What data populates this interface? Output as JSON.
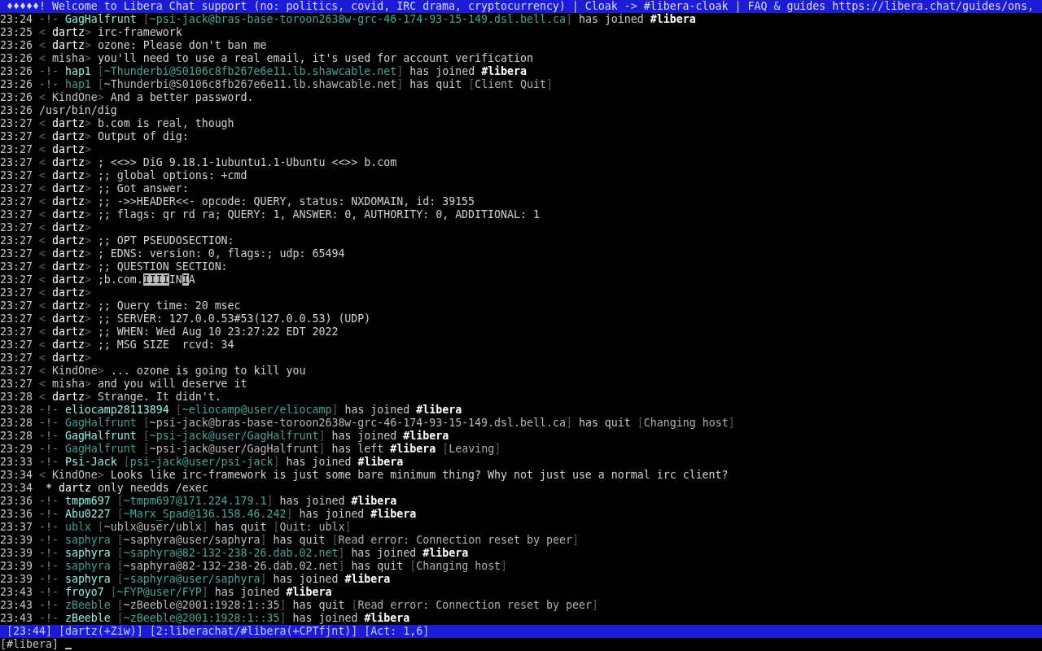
{
  "topic": "♦♦♦♦♦! Welcome to Libera Chat support (no: politics, covid, IRC drama, cryptocurrency) | Cloak -> #libera-cloak | FAQ & guides https://libera.chat/guides/ons,",
  "lines": [
    {
      "time": "23:24",
      "parts": [
        {
          "kind": "mark",
          "text": "-!-"
        },
        {
          "kind": "jnick",
          "text": " GagHalfrunt"
        },
        {
          "kind": "hb",
          "text": " ["
        },
        {
          "kind": "jhost",
          "text": "~psi-jack@bras-base-toroon2638w-grc-46-174-93-15-149.dsl.bell.ca"
        },
        {
          "kind": "hb",
          "text": "]"
        },
        {
          "kind": "verb",
          "text": " has joined"
        },
        {
          "kind": "chan",
          "text": " #libera"
        }
      ]
    },
    {
      "time": "23:25",
      "parts": [
        {
          "kind": "bracket",
          "text": "<"
        },
        {
          "kind": "self",
          "text": " dartz"
        },
        {
          "kind": "bracket",
          "text": ">"
        },
        {
          "kind": "text",
          "text": " irc-framework"
        }
      ]
    },
    {
      "time": "23:26",
      "parts": [
        {
          "kind": "bracket",
          "text": "<"
        },
        {
          "kind": "self",
          "text": " dartz"
        },
        {
          "kind": "bracket",
          "text": ">"
        },
        {
          "kind": "text",
          "text": " ozone: Please don't ban me"
        }
      ]
    },
    {
      "time": "23:26",
      "parts": [
        {
          "kind": "bracket",
          "text": "<"
        },
        {
          "kind": "nick",
          "text": " misha"
        },
        {
          "kind": "bracket",
          "text": ">"
        },
        {
          "kind": "text",
          "text": " you'll need to use a real email, it's used for account verification"
        }
      ]
    },
    {
      "time": "23:26",
      "parts": [
        {
          "kind": "mark",
          "text": "-!-"
        },
        {
          "kind": "jnick",
          "text": " hap1"
        },
        {
          "kind": "hb",
          "text": " ["
        },
        {
          "kind": "jhost",
          "text": "~Thunderbi@S0106c8fb267e6e11.lb.shawcable.net"
        },
        {
          "kind": "hb",
          "text": "]"
        },
        {
          "kind": "verb",
          "text": " has joined"
        },
        {
          "kind": "chan",
          "text": " #libera"
        }
      ]
    },
    {
      "time": "23:26",
      "parts": [
        {
          "kind": "mark",
          "text": "-!-"
        },
        {
          "kind": "qnick",
          "text": " hap1"
        },
        {
          "kind": "hb",
          "text": " ["
        },
        {
          "kind": "qhost",
          "text": "~Thunderbi@S0106c8fb267e6e11.lb.shawcable.net"
        },
        {
          "kind": "hb",
          "text": "]"
        },
        {
          "kind": "verb",
          "text": " has quit"
        },
        {
          "kind": "hb",
          "text": " ["
        },
        {
          "kind": "reason",
          "text": "Client Quit"
        },
        {
          "kind": "hb",
          "text": "]"
        }
      ]
    },
    {
      "time": "23:26",
      "parts": [
        {
          "kind": "bracket",
          "text": "<"
        },
        {
          "kind": "nick",
          "text": " KindOne"
        },
        {
          "kind": "bracket",
          "text": ">"
        },
        {
          "kind": "text",
          "text": " And a better password."
        }
      ]
    },
    {
      "time": "23:26",
      "parts": [
        {
          "kind": "text",
          "text": "/usr/bin/dig"
        }
      ]
    },
    {
      "time": "23:27",
      "parts": [
        {
          "kind": "bracket",
          "text": "<"
        },
        {
          "kind": "self",
          "text": " dartz"
        },
        {
          "kind": "bracket",
          "text": ">"
        },
        {
          "kind": "text",
          "text": " b.com is real, though"
        }
      ]
    },
    {
      "time": "23:27",
      "parts": [
        {
          "kind": "bracket",
          "text": "<"
        },
        {
          "kind": "self",
          "text": " dartz"
        },
        {
          "kind": "bracket",
          "text": ">"
        },
        {
          "kind": "text",
          "text": " Output of dig:"
        }
      ]
    },
    {
      "time": "23:27",
      "parts": [
        {
          "kind": "bracket",
          "text": "<"
        },
        {
          "kind": "self",
          "text": " dartz"
        },
        {
          "kind": "bracket",
          "text": ">"
        }
      ]
    },
    {
      "time": "23:27",
      "parts": [
        {
          "kind": "bracket",
          "text": "<"
        },
        {
          "kind": "self",
          "text": " dartz"
        },
        {
          "kind": "bracket",
          "text": ">"
        },
        {
          "kind": "text",
          "text": " ; <<>> DiG 9.18.1-1ubuntu1.1-Ubuntu <<>> b.com"
        }
      ]
    },
    {
      "time": "23:27",
      "parts": [
        {
          "kind": "bracket",
          "text": "<"
        },
        {
          "kind": "self",
          "text": " dartz"
        },
        {
          "kind": "bracket",
          "text": ">"
        },
        {
          "kind": "text",
          "text": " ;; global options: +cmd"
        }
      ]
    },
    {
      "time": "23:27",
      "parts": [
        {
          "kind": "bracket",
          "text": "<"
        },
        {
          "kind": "self",
          "text": " dartz"
        },
        {
          "kind": "bracket",
          "text": ">"
        },
        {
          "kind": "text",
          "text": " ;; Got answer:"
        }
      ]
    },
    {
      "time": "23:27",
      "parts": [
        {
          "kind": "bracket",
          "text": "<"
        },
        {
          "kind": "self",
          "text": " dartz"
        },
        {
          "kind": "bracket",
          "text": ">"
        },
        {
          "kind": "text",
          "text": " ;; ->>HEADER<<- opcode: QUERY, status: NXDOMAIN, id: 39155"
        }
      ]
    },
    {
      "time": "23:27",
      "parts": [
        {
          "kind": "bracket",
          "text": "<"
        },
        {
          "kind": "self",
          "text": " dartz"
        },
        {
          "kind": "bracket",
          "text": ">"
        },
        {
          "kind": "text",
          "text": " ;; flags: qr rd ra; QUERY: 1, ANSWER: 0, AUTHORITY: 0, ADDITIONAL: 1"
        }
      ]
    },
    {
      "time": "23:27",
      "parts": [
        {
          "kind": "bracket",
          "text": "<"
        },
        {
          "kind": "self",
          "text": " dartz"
        },
        {
          "kind": "bracket",
          "text": ">"
        }
      ]
    },
    {
      "time": "23:27",
      "parts": [
        {
          "kind": "bracket",
          "text": "<"
        },
        {
          "kind": "self",
          "text": " dartz"
        },
        {
          "kind": "bracket",
          "text": ">"
        },
        {
          "kind": "text",
          "text": " ;; OPT PSEUDOSECTION:"
        }
      ]
    },
    {
      "time": "23:27",
      "parts": [
        {
          "kind": "bracket",
          "text": "<"
        },
        {
          "kind": "self",
          "text": " dartz"
        },
        {
          "kind": "bracket",
          "text": ">"
        },
        {
          "kind": "text",
          "text": " ; EDNS: version: 0, flags:; udp: 65494"
        }
      ]
    },
    {
      "time": "23:27",
      "parts": [
        {
          "kind": "bracket",
          "text": "<"
        },
        {
          "kind": "self",
          "text": " dartz"
        },
        {
          "kind": "bracket",
          "text": ">"
        },
        {
          "kind": "text",
          "text": " ;; QUESTION SECTION:"
        }
      ]
    },
    {
      "time": "23:27",
      "parts": [
        {
          "kind": "bracket",
          "text": "<"
        },
        {
          "kind": "self",
          "text": " dartz"
        },
        {
          "kind": "bracket",
          "text": ">"
        },
        {
          "kind": "text",
          "text": " ;b.com."
        },
        {
          "kind": "rev",
          "text": "IIII"
        },
        {
          "kind": "text",
          "text": "IN"
        },
        {
          "kind": "rev",
          "text": "I"
        },
        {
          "kind": "text",
          "text": "A"
        }
      ]
    },
    {
      "time": "23:27",
      "parts": [
        {
          "kind": "bracket",
          "text": "<"
        },
        {
          "kind": "self",
          "text": " dartz"
        },
        {
          "kind": "bracket",
          "text": ">"
        }
      ]
    },
    {
      "time": "23:27",
      "parts": [
        {
          "kind": "bracket",
          "text": "<"
        },
        {
          "kind": "self",
          "text": " dartz"
        },
        {
          "kind": "bracket",
          "text": ">"
        },
        {
          "kind": "text",
          "text": " ;; Query time: 20 msec"
        }
      ]
    },
    {
      "time": "23:27",
      "parts": [
        {
          "kind": "bracket",
          "text": "<"
        },
        {
          "kind": "self",
          "text": " dartz"
        },
        {
          "kind": "bracket",
          "text": ">"
        },
        {
          "kind": "text",
          "text": " ;; SERVER: 127.0.0.53#53(127.0.0.53) (UDP)"
        }
      ]
    },
    {
      "time": "23:27",
      "parts": [
        {
          "kind": "bracket",
          "text": "<"
        },
        {
          "kind": "self",
          "text": " dartz"
        },
        {
          "kind": "bracket",
          "text": ">"
        },
        {
          "kind": "text",
          "text": " ;; WHEN: Wed Aug 10 23:27:22 EDT 2022"
        }
      ]
    },
    {
      "time": "23:27",
      "parts": [
        {
          "kind": "bracket",
          "text": "<"
        },
        {
          "kind": "self",
          "text": " dartz"
        },
        {
          "kind": "bracket",
          "text": ">"
        },
        {
          "kind": "text",
          "text": " ;; MSG SIZE  rcvd: 34"
        }
      ]
    },
    {
      "time": "23:27",
      "parts": [
        {
          "kind": "bracket",
          "text": "<"
        },
        {
          "kind": "self",
          "text": " dartz"
        },
        {
          "kind": "bracket",
          "text": ">"
        }
      ]
    },
    {
      "time": "23:27",
      "parts": [
        {
          "kind": "bracket",
          "text": "<"
        },
        {
          "kind": "nick",
          "text": " KindOne"
        },
        {
          "kind": "bracket",
          "text": ">"
        },
        {
          "kind": "text",
          "text": " ... ozone is going to kill you"
        }
      ]
    },
    {
      "time": "23:27",
      "parts": [
        {
          "kind": "bracket",
          "text": "<"
        },
        {
          "kind": "nick",
          "text": " misha"
        },
        {
          "kind": "bracket",
          "text": ">"
        },
        {
          "kind": "text",
          "text": " and you will deserve it"
        }
      ]
    },
    {
      "time": "23:28",
      "parts": [
        {
          "kind": "bracket",
          "text": "<"
        },
        {
          "kind": "self",
          "text": " dartz"
        },
        {
          "kind": "bracket",
          "text": ">"
        },
        {
          "kind": "text",
          "text": " Strange. It didn't."
        }
      ]
    },
    {
      "time": "23:28",
      "parts": [
        {
          "kind": "mark",
          "text": "-!-"
        },
        {
          "kind": "jnick",
          "text": " eliocamp28113894"
        },
        {
          "kind": "hb",
          "text": " ["
        },
        {
          "kind": "jhost",
          "text": "~eliocamp@user/eliocamp"
        },
        {
          "kind": "hb",
          "text": "]"
        },
        {
          "kind": "verb",
          "text": " has joined"
        },
        {
          "kind": "chan",
          "text": " #libera"
        }
      ]
    },
    {
      "time": "23:28",
      "parts": [
        {
          "kind": "mark",
          "text": "-!-"
        },
        {
          "kind": "qnick",
          "text": " GagHalfrunt"
        },
        {
          "kind": "hb",
          "text": " ["
        },
        {
          "kind": "qhost",
          "text": "~psi-jack@bras-base-toroon2638w-grc-46-174-93-15-149.dsl.bell.ca"
        },
        {
          "kind": "hb",
          "text": "]"
        },
        {
          "kind": "verb",
          "text": " has quit"
        },
        {
          "kind": "hb",
          "text": " ["
        },
        {
          "kind": "reason",
          "text": "Changing host"
        },
        {
          "kind": "hb",
          "text": "]"
        }
      ]
    },
    {
      "time": "23:28",
      "parts": [
        {
          "kind": "mark",
          "text": "-!-"
        },
        {
          "kind": "jnick",
          "text": " GagHalfrunt"
        },
        {
          "kind": "hb",
          "text": " ["
        },
        {
          "kind": "jhost",
          "text": "~psi-jack@user/GagHalfrunt"
        },
        {
          "kind": "hb",
          "text": "]"
        },
        {
          "kind": "verb",
          "text": " has joined"
        },
        {
          "kind": "chan",
          "text": " #libera"
        }
      ]
    },
    {
      "time": "23:29",
      "parts": [
        {
          "kind": "mark",
          "text": "-!-"
        },
        {
          "kind": "qnick",
          "text": " GagHalfrunt"
        },
        {
          "kind": "hb",
          "text": " ["
        },
        {
          "kind": "qhost",
          "text": "~psi-jack@user/GagHalfrunt"
        },
        {
          "kind": "hb",
          "text": "]"
        },
        {
          "kind": "verb",
          "text": " has left"
        },
        {
          "kind": "chan",
          "text": " #libera"
        },
        {
          "kind": "hb",
          "text": " ["
        },
        {
          "kind": "reason",
          "text": "Leaving"
        },
        {
          "kind": "hb",
          "text": "]"
        }
      ]
    },
    {
      "time": "23:33",
      "parts": [
        {
          "kind": "mark",
          "text": "-!-"
        },
        {
          "kind": "jnick",
          "text": " Psi-Jack"
        },
        {
          "kind": "hb",
          "text": " ["
        },
        {
          "kind": "jhost",
          "text": "psi-jack@user/psi-jack"
        },
        {
          "kind": "hb",
          "text": "]"
        },
        {
          "kind": "verb",
          "text": " has joined"
        },
        {
          "kind": "chan",
          "text": " #libera"
        }
      ]
    },
    {
      "time": "23:34",
      "parts": [
        {
          "kind": "bracket",
          "text": "<"
        },
        {
          "kind": "nick",
          "text": " KindOne"
        },
        {
          "kind": "bracket",
          "text": ">"
        },
        {
          "kind": "text",
          "text": " Looks like irc-framework is just some bare minimum thing? Why not just use a normal irc client?"
        }
      ]
    },
    {
      "time": "23:34",
      "parts": [
        {
          "kind": "star",
          "text": " *"
        },
        {
          "kind": "self",
          "text": " dartz"
        },
        {
          "kind": "text",
          "text": " only needds /exec"
        }
      ]
    },
    {
      "time": "23:36",
      "parts": [
        {
          "kind": "mark",
          "text": "-!-"
        },
        {
          "kind": "jnick",
          "text": " tmpm697"
        },
        {
          "kind": "hb",
          "text": " ["
        },
        {
          "kind": "jhost",
          "text": "~tmpm697@171.224.179.1"
        },
        {
          "kind": "hb",
          "text": "]"
        },
        {
          "kind": "verb",
          "text": " has joined"
        },
        {
          "kind": "chan",
          "text": " #libera"
        }
      ]
    },
    {
      "time": "23:36",
      "parts": [
        {
          "kind": "mark",
          "text": "-!-"
        },
        {
          "kind": "jnick",
          "text": " Abu0227"
        },
        {
          "kind": "hb",
          "text": " ["
        },
        {
          "kind": "jhost",
          "text": "~Marx_Spad@136.158.46.242"
        },
        {
          "kind": "hb",
          "text": "]"
        },
        {
          "kind": "verb",
          "text": " has joined"
        },
        {
          "kind": "chan",
          "text": " #libera"
        }
      ]
    },
    {
      "time": "23:37",
      "parts": [
        {
          "kind": "mark",
          "text": "-!-"
        },
        {
          "kind": "qnick",
          "text": " ublx"
        },
        {
          "kind": "hb",
          "text": " ["
        },
        {
          "kind": "qhost",
          "text": "~ublx@user/ublx"
        },
        {
          "kind": "hb",
          "text": "]"
        },
        {
          "kind": "verb",
          "text": " has quit"
        },
        {
          "kind": "hb",
          "text": " ["
        },
        {
          "kind": "reason",
          "text": "Quit: ublx"
        },
        {
          "kind": "hb",
          "text": "]"
        }
      ]
    },
    {
      "time": "23:39",
      "parts": [
        {
          "kind": "mark",
          "text": "-!-"
        },
        {
          "kind": "qnick",
          "text": " saphyra"
        },
        {
          "kind": "hb",
          "text": " ["
        },
        {
          "kind": "qhost",
          "text": "~saphyra@user/saphyra"
        },
        {
          "kind": "hb",
          "text": "]"
        },
        {
          "kind": "verb",
          "text": " has quit"
        },
        {
          "kind": "hb",
          "text": " ["
        },
        {
          "kind": "reason",
          "text": "Read error: Connection reset by peer"
        },
        {
          "kind": "hb",
          "text": "]"
        }
      ]
    },
    {
      "time": "23:39",
      "parts": [
        {
          "kind": "mark",
          "text": "-!-"
        },
        {
          "kind": "jnick",
          "text": " saphyra"
        },
        {
          "kind": "hb",
          "text": " ["
        },
        {
          "kind": "jhost",
          "text": "~saphyra@82-132-238-26.dab.02.net"
        },
        {
          "kind": "hb",
          "text": "]"
        },
        {
          "kind": "verb",
          "text": " has joined"
        },
        {
          "kind": "chan",
          "text": " #libera"
        }
      ]
    },
    {
      "time": "23:39",
      "parts": [
        {
          "kind": "mark",
          "text": "-!-"
        },
        {
          "kind": "qnick",
          "text": " saphyra"
        },
        {
          "kind": "hb",
          "text": " ["
        },
        {
          "kind": "qhost",
          "text": "~saphyra@82-132-238-26.dab.02.net"
        },
        {
          "kind": "hb",
          "text": "]"
        },
        {
          "kind": "verb",
          "text": " has quit"
        },
        {
          "kind": "hb",
          "text": " ["
        },
        {
          "kind": "reason",
          "text": "Changing host"
        },
        {
          "kind": "hb",
          "text": "]"
        }
      ]
    },
    {
      "time": "23:39",
      "parts": [
        {
          "kind": "mark",
          "text": "-!-"
        },
        {
          "kind": "jnick",
          "text": " saphyra"
        },
        {
          "kind": "hb",
          "text": " ["
        },
        {
          "kind": "jhost",
          "text": "~saphyra@user/saphyra"
        },
        {
          "kind": "hb",
          "text": "]"
        },
        {
          "kind": "verb",
          "text": " has joined"
        },
        {
          "kind": "chan",
          "text": " #libera"
        }
      ]
    },
    {
      "time": "23:43",
      "parts": [
        {
          "kind": "mark",
          "text": "-!-"
        },
        {
          "kind": "jnick",
          "text": " froyo7"
        },
        {
          "kind": "hb",
          "text": " ["
        },
        {
          "kind": "jhost",
          "text": "~FYP@user/FYP"
        },
        {
          "kind": "hb",
          "text": "]"
        },
        {
          "kind": "verb",
          "text": " has joined"
        },
        {
          "kind": "chan",
          "text": " #libera"
        }
      ]
    },
    {
      "time": "23:43",
      "parts": [
        {
          "kind": "mark",
          "text": "-!-"
        },
        {
          "kind": "qnick",
          "text": " zBeeble"
        },
        {
          "kind": "hb",
          "text": " ["
        },
        {
          "kind": "qhost",
          "text": "~zBeeble@2001:1928:1::35"
        },
        {
          "kind": "hb",
          "text": "]"
        },
        {
          "kind": "verb",
          "text": " has quit"
        },
        {
          "kind": "hb",
          "text": " ["
        },
        {
          "kind": "reason",
          "text": "Read error: Connection reset by peer"
        },
        {
          "kind": "hb",
          "text": "]"
        }
      ]
    },
    {
      "time": "23:43",
      "parts": [
        {
          "kind": "mark",
          "text": "-!-"
        },
        {
          "kind": "jnick",
          "text": " zBeeble"
        },
        {
          "kind": "hb",
          "text": " ["
        },
        {
          "kind": "jhost",
          "text": "~zBeeble@2001:1928:1::35"
        },
        {
          "kind": "hb",
          "text": "]"
        },
        {
          "kind": "verb",
          "text": " has joined"
        },
        {
          "kind": "chan",
          "text": " #libera"
        }
      ]
    }
  ],
  "status_bar": [
    "[23:44]",
    "[dartz(+Ziw)]",
    "[2:liberachat/#libera(+CPTfjnt)]",
    "[Act: 1,6]"
  ],
  "input": {
    "prompt": "[#libera]"
  }
}
